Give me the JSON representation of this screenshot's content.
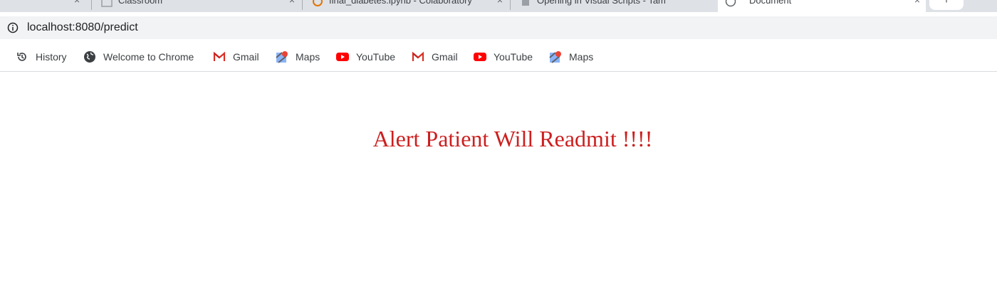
{
  "tabs": [
    {
      "title": "Classroom",
      "favicon": "classroom-icon"
    },
    {
      "title": "final_diabetes.ipynb - Colaboratory",
      "favicon": "colab-icon"
    },
    {
      "title": "Opening in Visual Scripts - Tam",
      "favicon": "generic-page-icon"
    },
    {
      "title": "Document",
      "favicon": "globe-icon",
      "active": true
    }
  ],
  "new_tab_label": "+",
  "address_bar": {
    "url": "localhost:8080/predict",
    "info_icon": "info-icon"
  },
  "bookmarks": [
    {
      "label": "History",
      "icon": "history-icon"
    },
    {
      "label": "Welcome to Chrome",
      "icon": "globe-icon"
    },
    {
      "label": "Gmail",
      "icon": "gmail-icon"
    },
    {
      "label": "Maps",
      "icon": "maps-icon"
    },
    {
      "label": "YouTube",
      "icon": "youtube-icon"
    },
    {
      "label": "Gmail",
      "icon": "gmail-icon"
    },
    {
      "label": "YouTube",
      "icon": "youtube-icon"
    },
    {
      "label": "Maps",
      "icon": "maps-icon"
    }
  ],
  "page": {
    "message": "Alert Patient Will Readmit !!!!",
    "message_color": "#cc1f1f"
  }
}
